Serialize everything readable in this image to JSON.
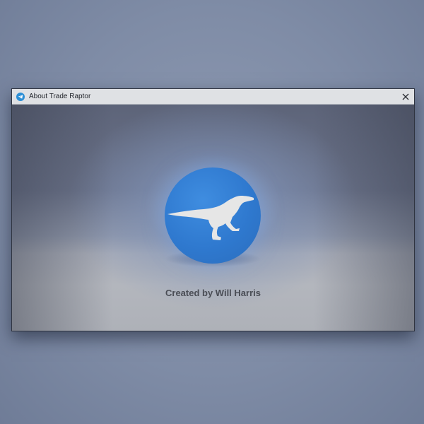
{
  "window": {
    "title": "About Trade Raptor",
    "app_icon": "telegram-plane-icon",
    "close_icon": "close-icon"
  },
  "content": {
    "logo_icon": "raptor-logo-icon",
    "credit": "Created by Will Harris"
  },
  "colors": {
    "accent": "#2f79cf",
    "logo_silhouette": "#e6e6e6",
    "credit_text": "#4a4d55"
  }
}
